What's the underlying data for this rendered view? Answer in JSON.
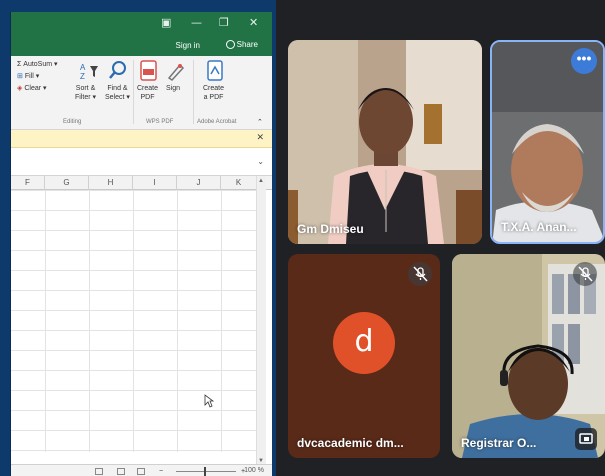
{
  "excel": {
    "signin": "Sign in",
    "share": "Share",
    "ribbon": {
      "autosum": "AutoSum",
      "fill": "Fill",
      "clear": "Clear",
      "sort_filter_1": "Sort &",
      "sort_filter_2": "Filter",
      "find_select_1": "Find &",
      "find_select_2": "Select",
      "create_pdf_1": "Create",
      "create_pdf_2": "PDF",
      "sign": "Sign",
      "create_a_pdf_1": "Create",
      "create_a_pdf_2": "a PDF",
      "group_editing": "Editing",
      "group_wps": "WPS PDF",
      "group_acrobat": "Adobe Acrobat"
    },
    "columns": [
      "F",
      "G",
      "H",
      "I",
      "J",
      "K"
    ],
    "zoom": "100 %"
  },
  "meet": {
    "participants": [
      {
        "name": "Gm Dmiseu"
      },
      {
        "name": "T.X.A. Anan..."
      },
      {
        "name": "dvcacademic dm...",
        "initial": "d"
      },
      {
        "name": "Registrar O..."
      }
    ]
  },
  "colors": {
    "excel_green": "#217346",
    "meet_background": "#202124",
    "avatar_orange": "#e0512a",
    "highlight_blue": "#8ab4f8"
  }
}
